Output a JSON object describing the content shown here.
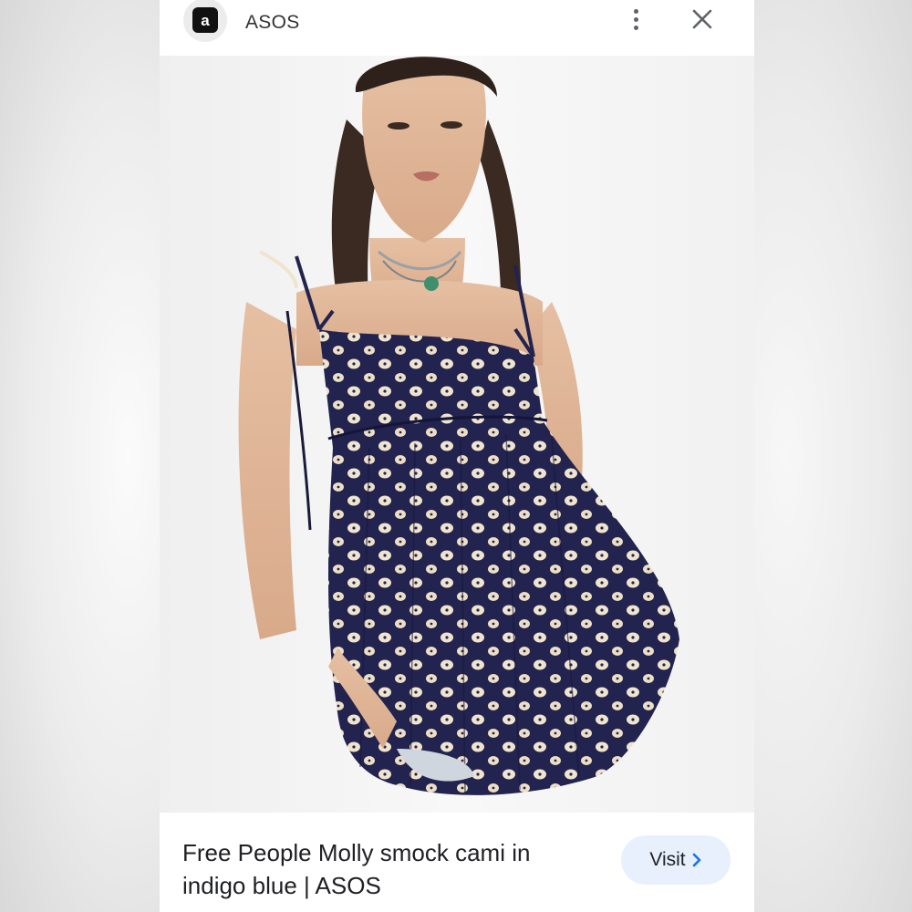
{
  "header": {
    "site_name": "ASOS",
    "logo_letter": "a",
    "menu_icon": "more-vert-icon",
    "close_icon": "close-icon"
  },
  "image": {
    "subject": "model wearing navy cami top with cream floral print"
  },
  "result": {
    "title": "Free People Molly smock cami in indigo blue | ASOS",
    "visit_label": "Visit",
    "visit_icon": "chevron-right-icon"
  },
  "colors": {
    "accent": "#1a73e8",
    "button_bg": "#e8f0fe",
    "dress": "#23234f",
    "print": "#efe4cc"
  }
}
